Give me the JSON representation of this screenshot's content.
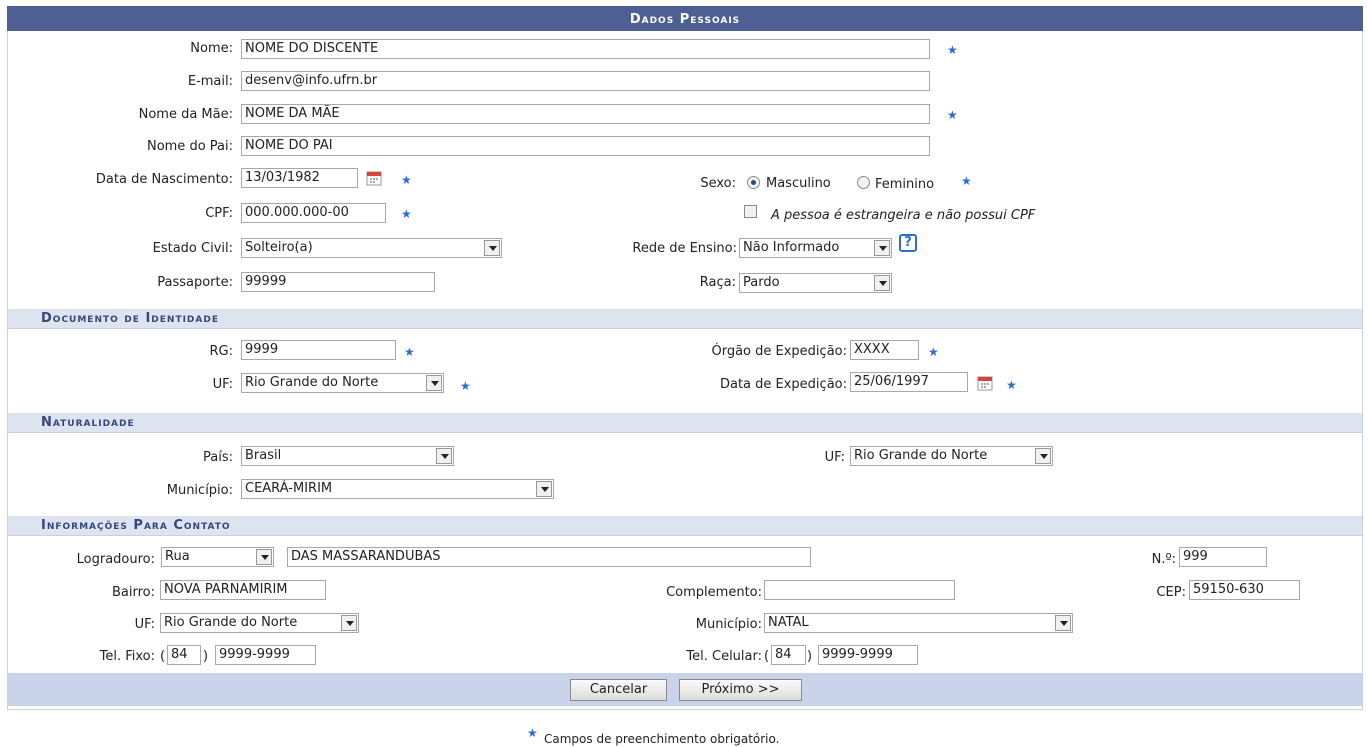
{
  "title": "Dados Pessoais",
  "labels": {
    "nome": "Nome:",
    "email": "E-mail:",
    "nome_mae": "Nome da Mãe:",
    "nome_pai": "Nome do Pai:",
    "data_nascimento": "Data de Nascimento:",
    "sexo": "Sexo:",
    "cpf": "CPF:",
    "estado_civil": "Estado Civil:",
    "rede_ensino": "Rede de Ensino:",
    "passaporte": "Passaporte:",
    "raca": "Raça:"
  },
  "values": {
    "nome": "NOME DO DISCENTE",
    "email": "desenv@info.ufrn.br",
    "nome_mae": "NOME DA MÃE",
    "nome_pai": "NOME DO PAI",
    "data_nascimento": "13/03/1982",
    "cpf": "000.000.000-00",
    "estado_civil": "Solteiro(a)",
    "rede_ensino": "Não Informado",
    "passaporte": "99999",
    "raca": "Pardo"
  },
  "sexo_options": {
    "masculino": "Masculino",
    "feminino": "Feminino",
    "selected": "Masculino"
  },
  "estrangeiro_label": "A pessoa é estrangeira e não possui CPF",
  "help_icon": "?",
  "required_star": "★",
  "documento": {
    "title": "Documento de Identidade",
    "rg_label": "RG:",
    "rg": "9999",
    "orgao_label": "Órgão de Expedição:",
    "orgao": "XXXX",
    "uf_label": "UF:",
    "uf": "Rio Grande do Norte",
    "data_exp_label": "Data de Expedição:",
    "data_exp": "25/06/1997"
  },
  "naturalidade": {
    "title": "Naturalidade",
    "pais_label": "País:",
    "pais": "Brasil",
    "uf_label": "UF:",
    "uf": "Rio Grande do Norte",
    "municipio_label": "Município:",
    "municipio": "CEARÁ-MIRIM"
  },
  "contato": {
    "title": "Informações Para Contato",
    "logradouro_label": "Logradouro:",
    "logradouro_tipo": "Rua",
    "logradouro": "DAS MASSARANDUBAS",
    "numero_label": "N.º:",
    "numero": "999",
    "bairro_label": "Bairro:",
    "bairro": "NOVA PARNAMIRIM",
    "complemento_label": "Complemento:",
    "complemento": "",
    "cep_label": "CEP:",
    "cep": "59150-630",
    "uf_label": "UF:",
    "uf": "Rio Grande do Norte",
    "municipio_label": "Município:",
    "municipio": "NATAL",
    "tel_fixo_label": "Tel. Fixo:",
    "tel_fixo_ddd": "84",
    "tel_fixo": "9999-9999",
    "tel_cel_label": "Tel. Celular:",
    "tel_cel_ddd": "84",
    "tel_cel": "9999-9999"
  },
  "buttons": {
    "cancelar": "Cancelar",
    "proximo": "Próximo >>"
  },
  "footnote": "Campos de preenchimento obrigatório.",
  "colors": {
    "title_bg": "#4e5f93",
    "section_bg": "#dee4ef",
    "section_text": "#35467a",
    "footer_bg": "#c9d4ea",
    "required_star": "#2c6fd1"
  }
}
